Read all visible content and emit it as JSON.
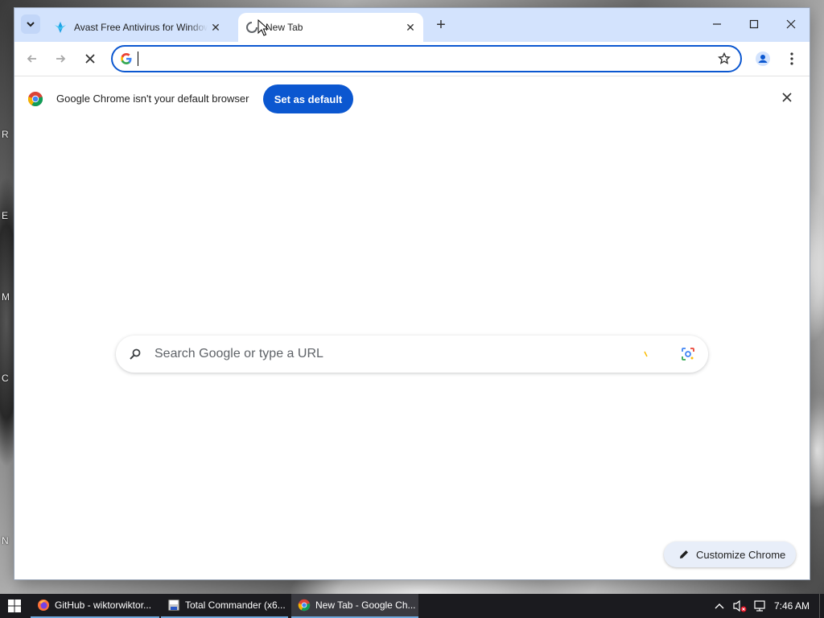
{
  "desktop": {
    "icon_labels": [
      "R",
      "E",
      "M",
      "C",
      "N"
    ]
  },
  "browser": {
    "tab_search_icon": "chevron-down-icon",
    "tabs": [
      {
        "title": "Avast Free Antivirus for Windows",
        "favicon": "avast-icon",
        "active": false
      },
      {
        "title": "New Tab",
        "favicon": "loading-spinner-icon",
        "active": true
      }
    ],
    "new_tab_symbol": "+",
    "window_controls": {
      "minimize": "minimize-icon",
      "maximize": "maximize-icon",
      "close": "close-icon"
    },
    "toolbar": {
      "back": "back-arrow-icon",
      "forward": "forward-arrow-icon",
      "stop": "stop-icon",
      "omnibox_value": "",
      "bookmark": "star-icon",
      "profile": "profile-icon",
      "menu": "kebab-menu-icon"
    },
    "infobar": {
      "message": "Google Chrome isn't your default browser",
      "button_label": "Set as default"
    },
    "ntp": {
      "search_placeholder": "Search Google or type a URL",
      "customize_label": "Customize Chrome"
    },
    "colors": {
      "accent": "#0b57d0",
      "tabstrip": "#d3e3fd"
    }
  },
  "taskbar": {
    "items": [
      {
        "label": "GitHub - wiktorwiktor...",
        "icon": "firefox-icon"
      },
      {
        "label": "Total Commander (x6...",
        "icon": "total-commander-icon"
      },
      {
        "label": "New Tab - Google Ch...",
        "icon": "chrome-icon"
      }
    ],
    "clock": "7:46 AM"
  }
}
